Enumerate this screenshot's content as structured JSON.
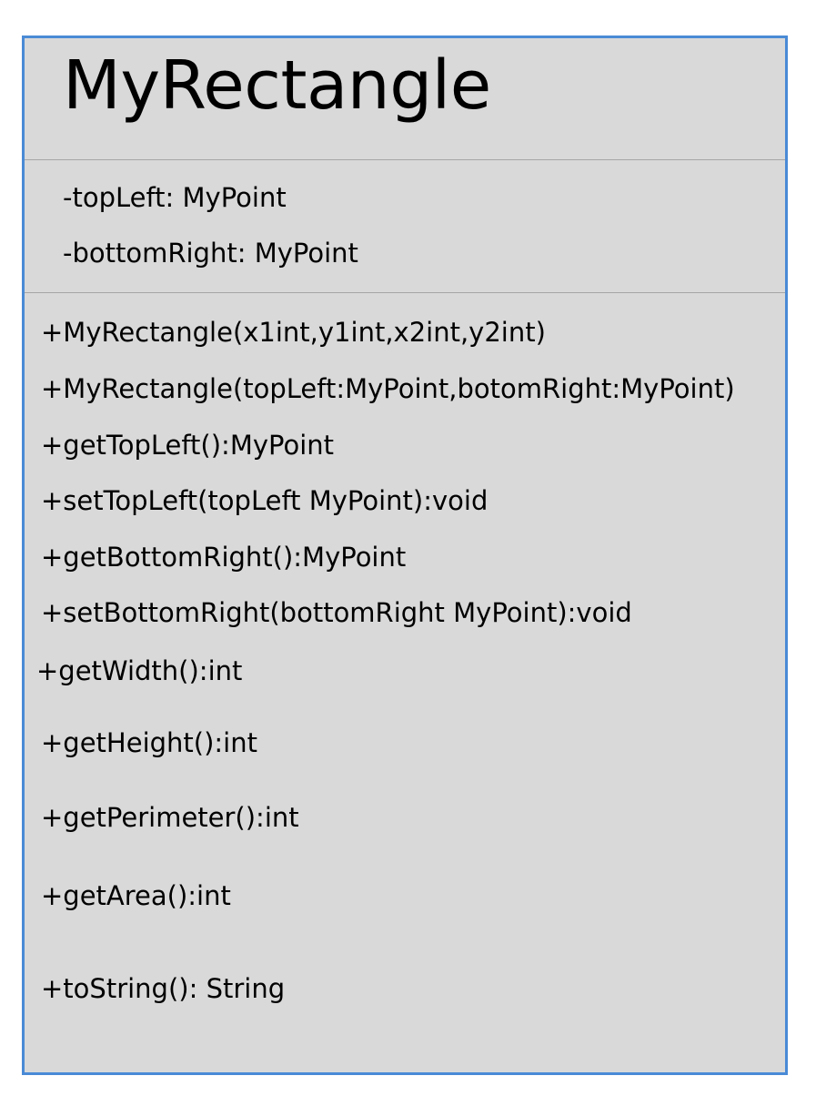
{
  "class": {
    "name": "MyRectangle",
    "attributes": [
      "-topLeft: MyPoint",
      "-bottomRight: MyPoint"
    ],
    "operations": [
      "+MyRectangle(x1int,y1int,x2int,y2int)",
      "+MyRectangle(topLeft:MyPoint,botomRight:MyPoint)",
      "+getTopLeft():MyPoint",
      "+setTopLeft(topLeft MyPoint):void",
      "+getBottomRight():MyPoint",
      "+setBottomRight(bottomRight MyPoint):void",
      "+getWidth():int",
      "+getHeight():int",
      "+getPerimeter():int",
      "+getArea():int",
      "+toString(): String"
    ]
  },
  "colors": {
    "box_fill": "#d9d9d9",
    "box_border": "#4a8ad6",
    "divider": "#a6a6a6",
    "text": "#000000"
  }
}
